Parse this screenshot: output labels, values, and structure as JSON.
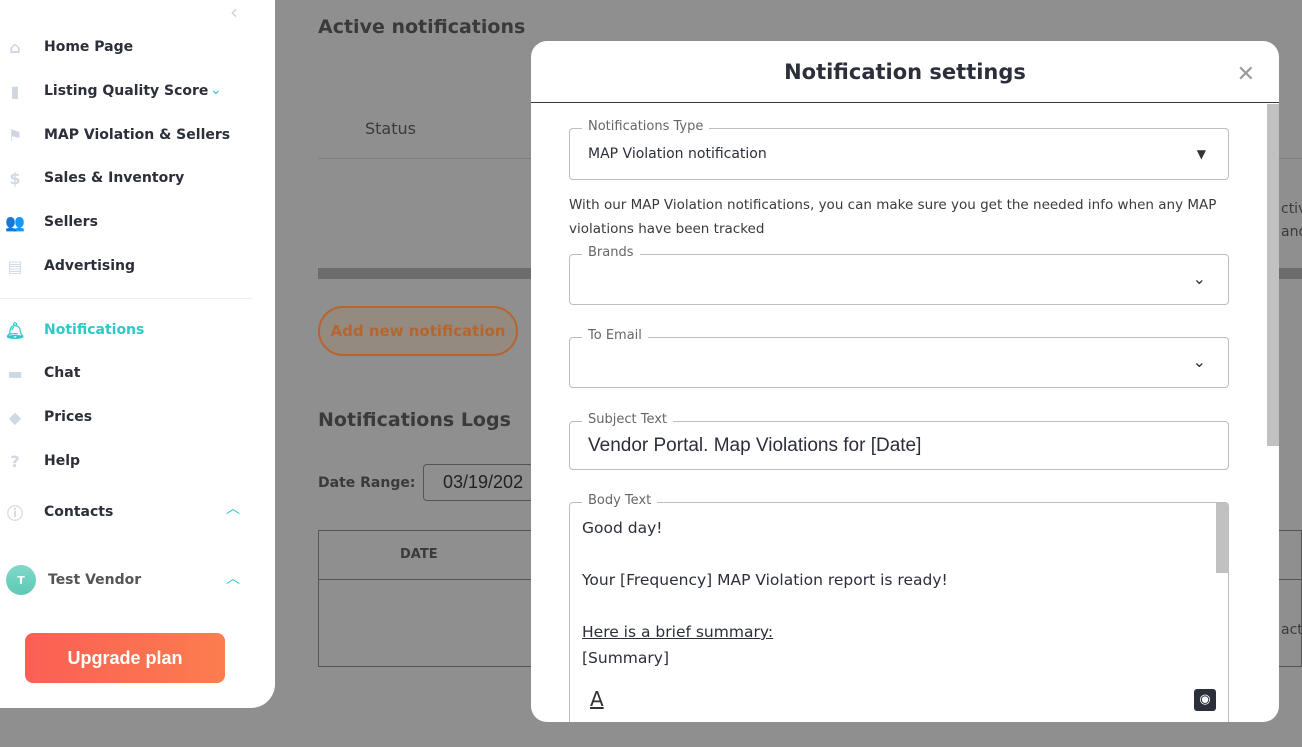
{
  "sidebar": {
    "items": [
      {
        "label": "Home Page",
        "icon": "home-icon"
      },
      {
        "label": "Listing Quality Score",
        "icon": "bar-chart-icon"
      },
      {
        "label": "MAP Violation & Sellers",
        "icon": "flag-icon"
      },
      {
        "label": "Sales & Inventory",
        "icon": "dollar-icon"
      },
      {
        "label": "Sellers",
        "icon": "users-icon"
      },
      {
        "label": "Advertising",
        "icon": "document-icon"
      },
      {
        "label": "Notifications",
        "icon": "bell-icon"
      },
      {
        "label": "Chat",
        "icon": "chat-icon"
      },
      {
        "label": "Prices",
        "icon": "tag-icon"
      },
      {
        "label": "Help",
        "icon": "help-icon"
      },
      {
        "label": "Contacts",
        "icon": "info-icon"
      }
    ],
    "user": {
      "initial": "T",
      "name": "Test Vendor"
    },
    "upgrade": "Upgrade plan",
    "accent": "#2ec8c8"
  },
  "main": {
    "active_title": "Active notifications",
    "status_header": "Status",
    "add_button": "Add new notification",
    "logs_title": "Notifications Logs",
    "date_range_label": "Date Range:",
    "date_value": "03/19/202",
    "date_header": "DATE",
    "clip1": "ctiv",
    "clip2": "and",
    "clip3": "act"
  },
  "modal": {
    "title": "Notification settings",
    "type_label": "Notifications Type",
    "type_value": "MAP Violation notification",
    "description": "With our MAP Violation notifications, you can make sure you get the needed info when any MAP violations have been tracked",
    "brands_label": "Brands",
    "email_label": "To Email",
    "subject_label": "Subject Text",
    "subject_value": "Vendor Portal. Map Violations for [Date]",
    "body_label": "Body Text",
    "body_lines": [
      "Good day!",
      "",
      "Your [Frequency] MAP Violation report is ready!",
      "",
      "Here is a brief summary:",
      "[Summary]"
    ]
  }
}
